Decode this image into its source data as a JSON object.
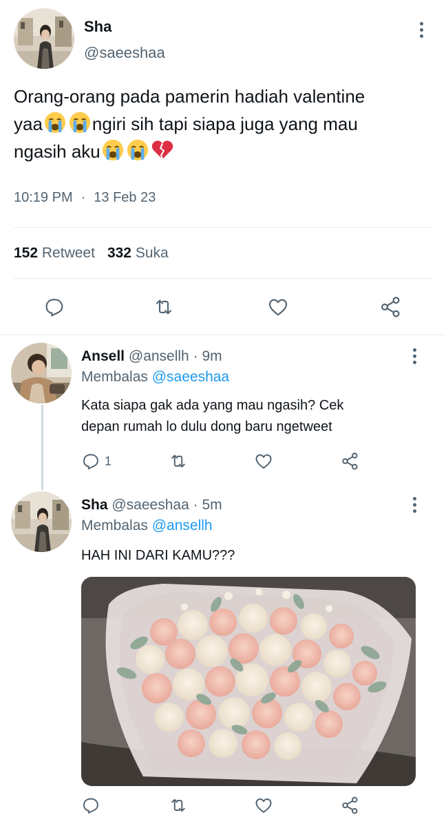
{
  "main_tweet": {
    "display_name": "Sha",
    "handle": "@saeeshaa",
    "text_line1": "Orang-orang pada pamerin hadiah valentine",
    "text_line2_a": "yaa",
    "text_line2_b": "ngiri sih tapi siapa juga yang mau",
    "text_line3_a": "ngasih aku",
    "emoji_icons": [
      "loudly-crying-face",
      "loudly-crying-face",
      "loudly-crying-face",
      "loudly-crying-face",
      "broken-heart"
    ],
    "time": "10:19 PM",
    "separator": "·",
    "date": "13 Feb 23",
    "retweet_count": "152",
    "retweet_label": "Retweet",
    "like_count": "332",
    "like_label": "Suka"
  },
  "replies": [
    {
      "display_name": "Ansell",
      "handle": "@ansellh",
      "separator": "·",
      "time_ago": "9m",
      "replying_prefix": "Membalas",
      "replying_to": "@saeeshaa",
      "text_line1": "Kata siapa gak ada yang mau ngasih? Cek",
      "text_line2": "depan rumah lo dulu dong baru ngetweet",
      "reply_count": "1"
    },
    {
      "display_name": "Sha",
      "handle": "@saeeshaa",
      "separator": "·",
      "time_ago": "5m",
      "replying_prefix": "Membalas",
      "replying_to": "@ansellh",
      "text_line1": "HAH INI DARI KAMU???",
      "photo_subject": "bouquet of pink and cream roses with eucalyptus"
    }
  ],
  "colors": {
    "text_primary": "#0f1419",
    "text_secondary": "#536471",
    "link": "#1d9bf0",
    "divider": "#e6ecf0",
    "broken_heart": "#e0245e"
  }
}
